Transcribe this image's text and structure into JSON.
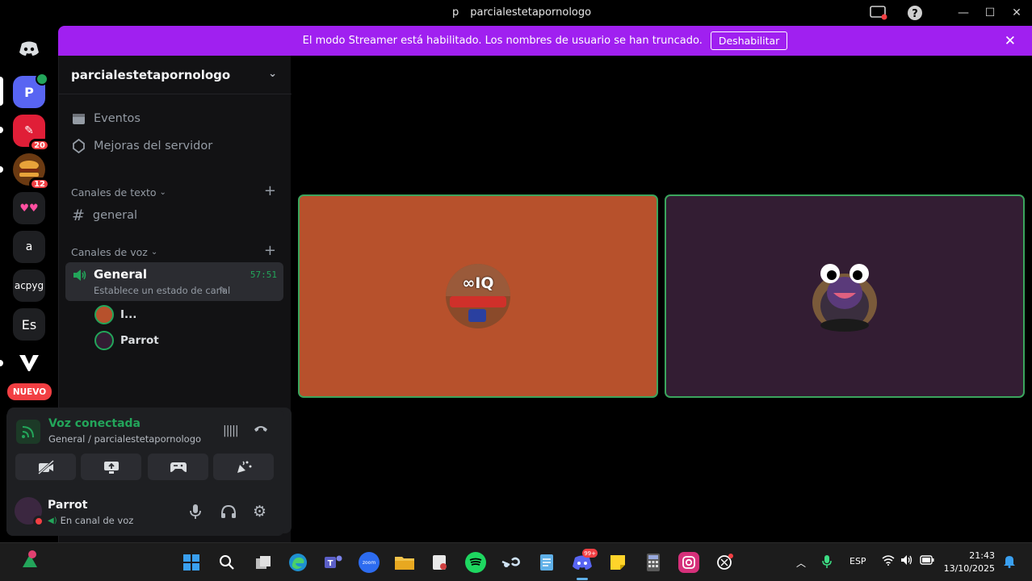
{
  "window": {
    "title_prefix": "p",
    "title": "parcialestetapornologo"
  },
  "banner": {
    "text": "El modo Streamer está habilitado. Los nombres de usuario se han truncado.",
    "button_label": "Deshabilitar",
    "color": "#a020f0"
  },
  "rail": {
    "servers": [
      {
        "label": "P",
        "name": "server-p",
        "color": "#5865f2"
      },
      {
        "label": "",
        "name": "server-red",
        "color": "#e01e37",
        "badge": "20"
      },
      {
        "label": "",
        "name": "server-burger",
        "color": "#3a2a1a",
        "badge": "12"
      },
      {
        "label": "💗💗",
        "name": "server-hearts",
        "color": "#1e1f22"
      },
      {
        "label": "a",
        "name": "server-a",
        "color": "#1e1f22"
      },
      {
        "label": "acpyg",
        "name": "server-acpyg",
        "color": "#1e1f22"
      },
      {
        "label": "Es",
        "name": "server-es",
        "color": "#1e1f22"
      },
      {
        "label": "",
        "name": "server-v",
        "color": "#000000"
      }
    ],
    "new_badge": "NUEVO"
  },
  "sidebar": {
    "server_name": "parcialestetapornologo",
    "events_label": "Eventos",
    "boosts_label": "Mejoras del servidor",
    "text_category": "Canales de texto",
    "text_channel": "general",
    "voice_category": "Canales de voz",
    "voice_channel": {
      "name": "General",
      "status": "Establece un estado de canal",
      "timer": "57:51"
    },
    "members": [
      "I...",
      "Parrot"
    ]
  },
  "voice_panel": {
    "status": "Voz conectada",
    "location": "General / parcialestetapornologo",
    "status_color": "#23a55a"
  },
  "user": {
    "name": "Parrot",
    "status": "En canal de voz"
  },
  "tiles": {
    "left_avatar_text": "∞IQ",
    "left_color": "#b7512c",
    "right_color": "#331d33",
    "speaking_border": "#3ba55d"
  },
  "taskbar": {
    "lang": "ESP",
    "time": "21:43",
    "date": "13/10/2025",
    "discord_badge": "99+"
  }
}
